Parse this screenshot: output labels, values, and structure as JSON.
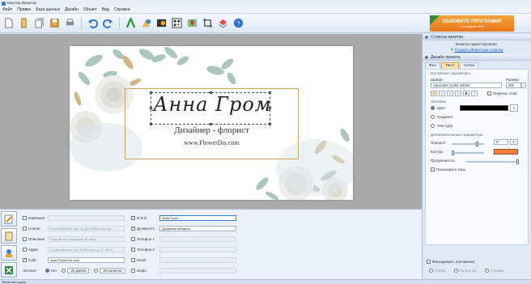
{
  "window": {
    "title": "Мастер Визиток"
  },
  "menu": [
    "Файл",
    "Правка",
    "База данных",
    "Дизайн",
    "Объект",
    "Вид",
    "Справка"
  ],
  "toolbar": {
    "icons": [
      "new-file-icon",
      "open-template-icon",
      "open-folder-icon",
      "save-icon",
      "print-icon",
      "undo-icon",
      "redo-icon",
      "text-icon",
      "shapes-icon",
      "image-icon",
      "qr-code-icon",
      "map-icon",
      "crop-icon",
      "layers-icon",
      "help-icon"
    ]
  },
  "promo": {
    "line1": "ОБНОВИТЕ ПРОГРАММУ",
    "line2": "со скидкой 50%"
  },
  "card": {
    "name": "Анна Гром",
    "role": "Дизайнер - флорист",
    "site": "www.FlowerDis.com"
  },
  "right_panel": {
    "sides_header": "Стороны визитки",
    "sides_info": "Визитка односторонняя.",
    "create_back_link": "Создать оборотную сторону",
    "design_header": "Дизайн проекта",
    "tabs": [
      "Фон",
      "Текст",
      "Сетка"
    ],
    "active_tab": "Текст",
    "basic_params": "Основные параметры:",
    "font_label": "Шрифт:",
    "font_value": "Alexander Gothic Whole",
    "size_label": "Размер:",
    "size_value": "400",
    "wrap_label": "Перенос слов",
    "fill_label": "Заливка:",
    "fill_color_label": "Цвет",
    "fill_gradient_label": "Градиент",
    "fill_texture_label": "Текстура",
    "extra_params": "Дополнительные параметры:",
    "rotation_label": "Поворот:",
    "rotation_value": "0°",
    "outline_label": "Контур:",
    "transparency_label": "Прозрачность:",
    "shadow_label": "Показывать тень",
    "fix_position_label": "Фиксировать положение:",
    "fix_left": "Слева",
    "fix_center": "По центру",
    "fix_right": "Справа",
    "colors": {
      "fill": "#000000",
      "outline": "#f0803c"
    }
  },
  "fields_left": [
    {
      "label": "Компания",
      "value": "",
      "checked": false
    },
    {
      "label": "Слоган",
      "value": "Качественный сайт по доступным ценам",
      "checked": false
    },
    {
      "label": "Описание",
      "value": "Разработка программ на заказ",
      "checked": false
    },
    {
      "label": "Адрес",
      "value": "г. Комсомольск, ул. Советская, д.47, кв.10",
      "checked": false
    },
    {
      "label": "Сайт",
      "value": "www.FlowerDis.com",
      "checked": true
    }
  ],
  "fields_right": [
    {
      "label": "Ф.И.О.",
      "value": "Анна Гром",
      "checked": true
    },
    {
      "label": "Должность",
      "value": "Дизайнер-флорист",
      "checked": true
    },
    {
      "label": "Телефон 1",
      "value": "",
      "checked": false
    },
    {
      "label": "Телефон 2",
      "value": "",
      "checked": false
    },
    {
      "label": "Email",
      "value": "",
      "checked": false
    },
    {
      "label": "Инфо",
      "value": "",
      "checked": false
    }
  ],
  "logo_row": {
    "label": "Логотип:",
    "option_none": "Нет",
    "option_file": "Из файла",
    "option_catalog": "Из каталога"
  },
  "status": {
    "text": "Визитная карта"
  }
}
